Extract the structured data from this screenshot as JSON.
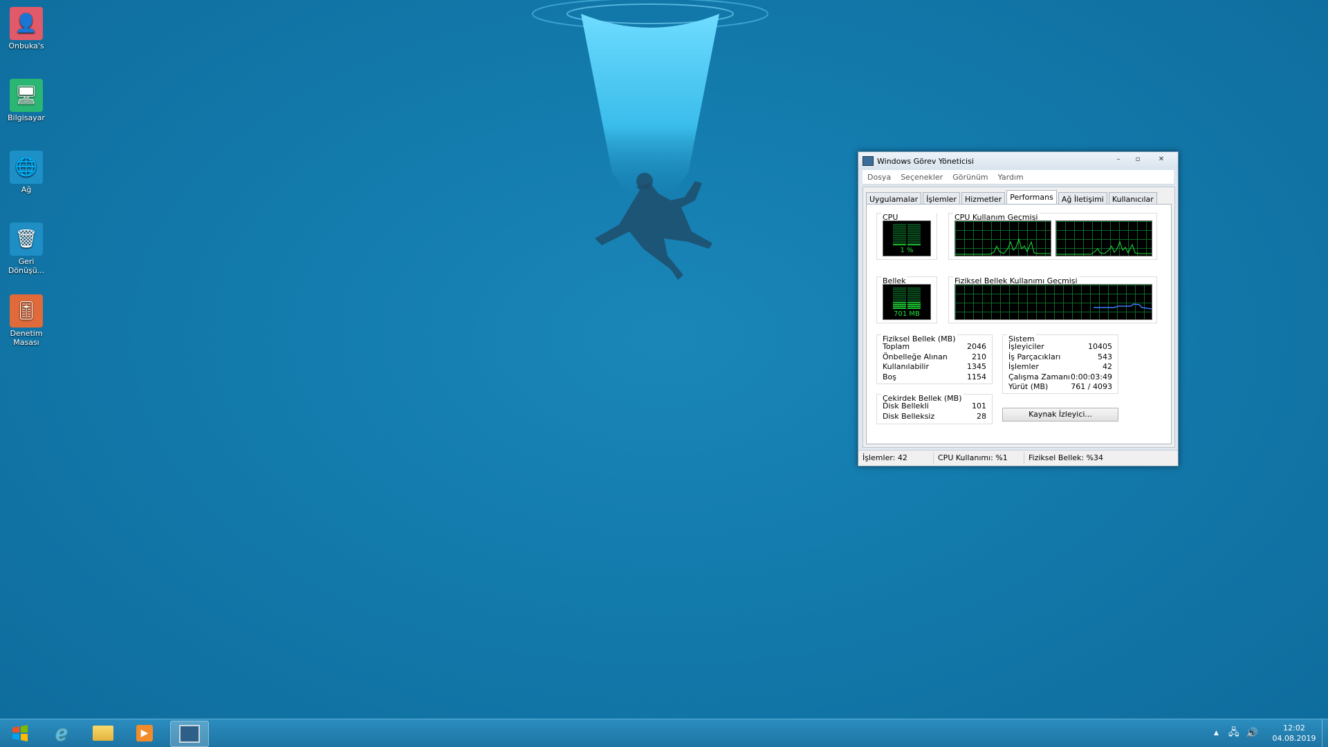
{
  "desktop": {
    "icons": [
      {
        "label": "Onbuka's",
        "icon": "user-icon",
        "color": "#e05a6a"
      },
      {
        "label": "Bilgisayar",
        "icon": "computer-icon",
        "color": "#2bb673"
      },
      {
        "label": "Ağ",
        "icon": "network-globe-icon",
        "color": "#1e90c8"
      },
      {
        "label": "Geri Dönüşü...",
        "icon": "recycle-bin-icon",
        "color": "#1e8ec5"
      },
      {
        "label": "Denetim Masası",
        "icon": "control-panel-icon",
        "color": "#e06a3a"
      }
    ]
  },
  "taskbar": {
    "buttons": [
      "start-icon",
      "internet-explorer-icon",
      "file-explorer-icon",
      "media-player-icon",
      "task-manager-icon"
    ],
    "clock": {
      "time": "12:02",
      "date": "04.08.2019"
    }
  },
  "window": {
    "title": "Windows Görev Yöneticisi",
    "controls": {
      "minimize": "–",
      "maximize": "▫",
      "close": "✕"
    },
    "menu": [
      "Dosya",
      "Seçenekler",
      "Görünüm",
      "Yardım"
    ],
    "tabs": [
      "Uygulamalar",
      "İşlemler",
      "Hizmetler",
      "Performans",
      "Ağ İletişimi",
      "Kullanıcılar"
    ],
    "active_tab": "Performans",
    "cpu_usage": {
      "title": "CPU Kullanımı",
      "value": "1 %",
      "level": 0.01
    },
    "cpu_history": {
      "title": "CPU Kullanım Geçmişi"
    },
    "memory": {
      "title": "Bellek",
      "value": "701 MB",
      "level": 0.34
    },
    "memory_history": {
      "title": "Fiziksel Bellek Kullanımı Geçmişi"
    },
    "physical_memory": {
      "title": "Fiziksel Bellek (MB)",
      "rows": [
        {
          "label": "Toplam",
          "value": "2046"
        },
        {
          "label": "Önbelleğe Alınan",
          "value": "210"
        },
        {
          "label": "Kullanılabilir",
          "value": "1345"
        },
        {
          "label": "Boş",
          "value": "1154"
        }
      ]
    },
    "kernel_memory": {
      "title": "Çekirdek Bellek (MB)",
      "rows": [
        {
          "label": "Disk Bellekli",
          "value": "101"
        },
        {
          "label": "Disk Belleksiz",
          "value": "28"
        }
      ]
    },
    "system": {
      "title": "Sistem",
      "rows": [
        {
          "label": "İşleyiciler",
          "value": "10405"
        },
        {
          "label": "İş Parçacıkları",
          "value": "543"
        },
        {
          "label": "İşlemler",
          "value": "42"
        },
        {
          "label": "Çalışma Zamanı",
          "value": "0:00:03:49"
        },
        {
          "label": "Yürüt (MB)",
          "value": "761 / 4093"
        }
      ]
    },
    "resource_monitor_button": "Kaynak İzleyici...",
    "status": {
      "processes": "İşlemler: 42",
      "cpu": "CPU Kullanımı: %1",
      "memory": "Fiziksel Bellek: %34"
    }
  },
  "colors": {
    "graph_green": "#21e23a",
    "grid": "#0b6b2b",
    "memory_line": "#3a7bff"
  }
}
